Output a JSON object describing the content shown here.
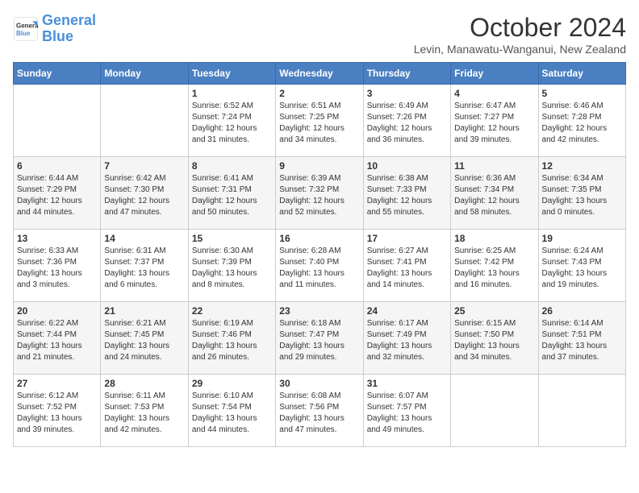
{
  "header": {
    "logo_general": "General",
    "logo_blue": "Blue",
    "month_title": "October 2024",
    "location": "Levin, Manawatu-Wanganui, New Zealand"
  },
  "days_of_week": [
    "Sunday",
    "Monday",
    "Tuesday",
    "Wednesday",
    "Thursday",
    "Friday",
    "Saturday"
  ],
  "weeks": [
    [
      {
        "day": "",
        "info": ""
      },
      {
        "day": "",
        "info": ""
      },
      {
        "day": "1",
        "info": "Sunrise: 6:52 AM\nSunset: 7:24 PM\nDaylight: 12 hours\nand 31 minutes."
      },
      {
        "day": "2",
        "info": "Sunrise: 6:51 AM\nSunset: 7:25 PM\nDaylight: 12 hours\nand 34 minutes."
      },
      {
        "day": "3",
        "info": "Sunrise: 6:49 AM\nSunset: 7:26 PM\nDaylight: 12 hours\nand 36 minutes."
      },
      {
        "day": "4",
        "info": "Sunrise: 6:47 AM\nSunset: 7:27 PM\nDaylight: 12 hours\nand 39 minutes."
      },
      {
        "day": "5",
        "info": "Sunrise: 6:46 AM\nSunset: 7:28 PM\nDaylight: 12 hours\nand 42 minutes."
      }
    ],
    [
      {
        "day": "6",
        "info": "Sunrise: 6:44 AM\nSunset: 7:29 PM\nDaylight: 12 hours\nand 44 minutes."
      },
      {
        "day": "7",
        "info": "Sunrise: 6:42 AM\nSunset: 7:30 PM\nDaylight: 12 hours\nand 47 minutes."
      },
      {
        "day": "8",
        "info": "Sunrise: 6:41 AM\nSunset: 7:31 PM\nDaylight: 12 hours\nand 50 minutes."
      },
      {
        "day": "9",
        "info": "Sunrise: 6:39 AM\nSunset: 7:32 PM\nDaylight: 12 hours\nand 52 minutes."
      },
      {
        "day": "10",
        "info": "Sunrise: 6:38 AM\nSunset: 7:33 PM\nDaylight: 12 hours\nand 55 minutes."
      },
      {
        "day": "11",
        "info": "Sunrise: 6:36 AM\nSunset: 7:34 PM\nDaylight: 12 hours\nand 58 minutes."
      },
      {
        "day": "12",
        "info": "Sunrise: 6:34 AM\nSunset: 7:35 PM\nDaylight: 13 hours\nand 0 minutes."
      }
    ],
    [
      {
        "day": "13",
        "info": "Sunrise: 6:33 AM\nSunset: 7:36 PM\nDaylight: 13 hours\nand 3 minutes."
      },
      {
        "day": "14",
        "info": "Sunrise: 6:31 AM\nSunset: 7:37 PM\nDaylight: 13 hours\nand 6 minutes."
      },
      {
        "day": "15",
        "info": "Sunrise: 6:30 AM\nSunset: 7:39 PM\nDaylight: 13 hours\nand 8 minutes."
      },
      {
        "day": "16",
        "info": "Sunrise: 6:28 AM\nSunset: 7:40 PM\nDaylight: 13 hours\nand 11 minutes."
      },
      {
        "day": "17",
        "info": "Sunrise: 6:27 AM\nSunset: 7:41 PM\nDaylight: 13 hours\nand 14 minutes."
      },
      {
        "day": "18",
        "info": "Sunrise: 6:25 AM\nSunset: 7:42 PM\nDaylight: 13 hours\nand 16 minutes."
      },
      {
        "day": "19",
        "info": "Sunrise: 6:24 AM\nSunset: 7:43 PM\nDaylight: 13 hours\nand 19 minutes."
      }
    ],
    [
      {
        "day": "20",
        "info": "Sunrise: 6:22 AM\nSunset: 7:44 PM\nDaylight: 13 hours\nand 21 minutes."
      },
      {
        "day": "21",
        "info": "Sunrise: 6:21 AM\nSunset: 7:45 PM\nDaylight: 13 hours\nand 24 minutes."
      },
      {
        "day": "22",
        "info": "Sunrise: 6:19 AM\nSunset: 7:46 PM\nDaylight: 13 hours\nand 26 minutes."
      },
      {
        "day": "23",
        "info": "Sunrise: 6:18 AM\nSunset: 7:47 PM\nDaylight: 13 hours\nand 29 minutes."
      },
      {
        "day": "24",
        "info": "Sunrise: 6:17 AM\nSunset: 7:49 PM\nDaylight: 13 hours\nand 32 minutes."
      },
      {
        "day": "25",
        "info": "Sunrise: 6:15 AM\nSunset: 7:50 PM\nDaylight: 13 hours\nand 34 minutes."
      },
      {
        "day": "26",
        "info": "Sunrise: 6:14 AM\nSunset: 7:51 PM\nDaylight: 13 hours\nand 37 minutes."
      }
    ],
    [
      {
        "day": "27",
        "info": "Sunrise: 6:12 AM\nSunset: 7:52 PM\nDaylight: 13 hours\nand 39 minutes."
      },
      {
        "day": "28",
        "info": "Sunrise: 6:11 AM\nSunset: 7:53 PM\nDaylight: 13 hours\nand 42 minutes."
      },
      {
        "day": "29",
        "info": "Sunrise: 6:10 AM\nSunset: 7:54 PM\nDaylight: 13 hours\nand 44 minutes."
      },
      {
        "day": "30",
        "info": "Sunrise: 6:08 AM\nSunset: 7:56 PM\nDaylight: 13 hours\nand 47 minutes."
      },
      {
        "day": "31",
        "info": "Sunrise: 6:07 AM\nSunset: 7:57 PM\nDaylight: 13 hours\nand 49 minutes."
      },
      {
        "day": "",
        "info": ""
      },
      {
        "day": "",
        "info": ""
      }
    ]
  ]
}
